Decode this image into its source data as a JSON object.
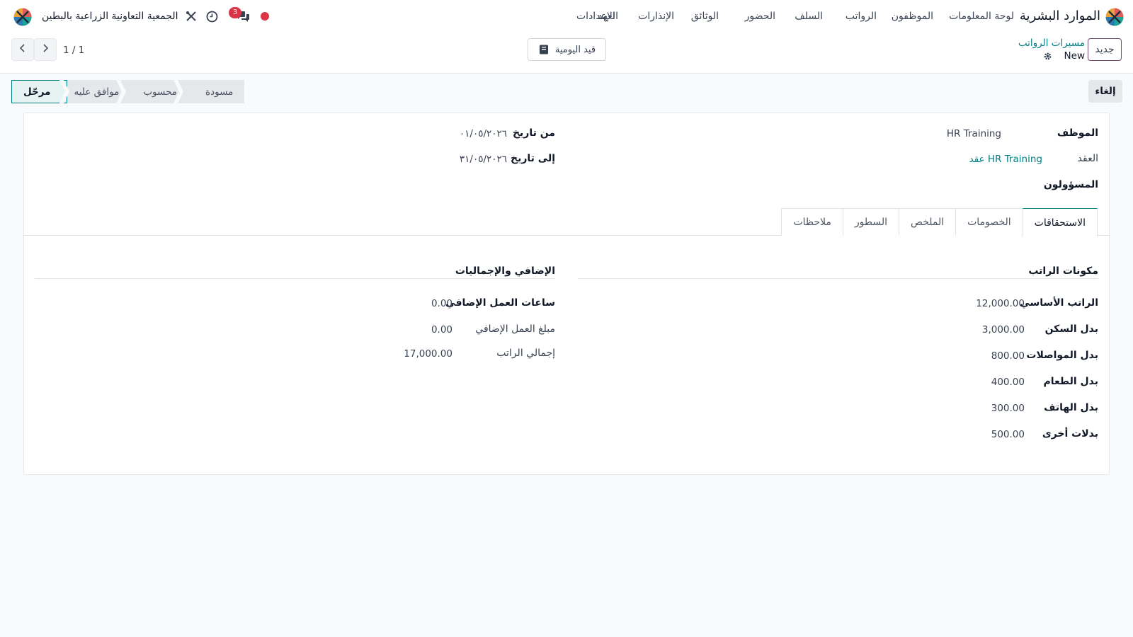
{
  "navbar": {
    "brand": "الموارد البشرية",
    "menu": [
      "لوحة المعلومات",
      "الموظفون",
      "الرواتب",
      "السلف",
      "الحضور",
      "الوثائق",
      "الإنذارات",
      "العهد",
      "الإعدادات"
    ],
    "company": "الجمعية التعاونية الزراعية بالبطين",
    "messages_badge": "3",
    "icons": [
      "apps-logo-icon",
      "chat-icon",
      "clock-icon",
      "tools-icon",
      "activity-dot-icon",
      "user-avatar-icon"
    ]
  },
  "control_panel": {
    "new_button": "جديد",
    "breadcrumb_parent": "مسيرات الرواتب",
    "record_name": "New",
    "journal_button": "قيد اليومية",
    "pager": "1 / 1"
  },
  "statusbar": {
    "cancel_button": "إلغاء",
    "stages": [
      "مسودة",
      "محسوب",
      "موافق عليه",
      "مرحّل"
    ],
    "active_stage": "مرحّل"
  },
  "form": {
    "employee_label": "الموظف",
    "employee_value": "HR Training",
    "contract_label": "العقد",
    "contract_value": "عقد HR Training",
    "responsibles_label": "المسؤولون",
    "date_from_label": "من تاريخ",
    "date_from_value": "٠١/٠٥/٢٠٢٦",
    "date_to_label": "إلى تاريخ",
    "date_to_value": "٣١/٠٥/٢٠٢٦"
  },
  "tabs": [
    "الاستحقاقات",
    "الخصومات",
    "الملخص",
    "السطور",
    "ملاحظات"
  ],
  "active_tab": "الاستحقاقات",
  "components": {
    "title": "مكونات الراتب",
    "rows": [
      {
        "label": "الراتب الأساسي",
        "value": "12,000.00"
      },
      {
        "label": "بدل السكن",
        "value": "3,000.00"
      },
      {
        "label": "بدل المواصلات",
        "value": "800.00"
      },
      {
        "label": "بدل الطعام",
        "value": "400.00"
      },
      {
        "label": "بدل الهاتف",
        "value": "300.00"
      },
      {
        "label": "بدلات أخرى",
        "value": "500.00"
      }
    ]
  },
  "overtime": {
    "title": "الإضافي والإجماليات",
    "rows": [
      {
        "label": "ساعات العمل الإضافي",
        "value": "0.00"
      },
      {
        "label": "مبلغ العمل الإضافي",
        "value": "0.00"
      },
      {
        "label": "إجمالي الراتب",
        "value": "17,000.00"
      }
    ]
  },
  "colors": {
    "accent": "#017e84",
    "brand": "#714b67",
    "badge": "#dc3545"
  }
}
